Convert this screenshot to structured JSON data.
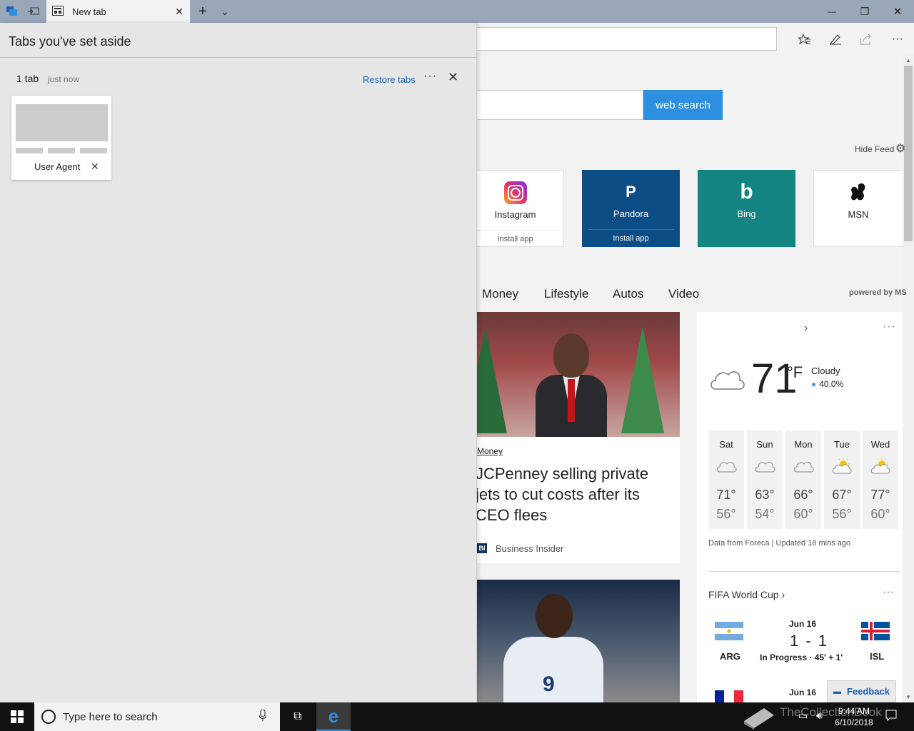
{
  "titlebar": {
    "tab_title": "New tab",
    "tab_close": "✕",
    "new_tab": "+",
    "tab_list": "⌄",
    "minimize": "—",
    "restore": "❐",
    "close": "✕",
    "color": "#9aa7b8"
  },
  "toolbar": {
    "favorites_icon": "star-list-icon",
    "notes_icon": "pen-icon",
    "share_icon": "share-icon",
    "more_icon": "ellipsis-icon",
    "more_label": "···"
  },
  "ntp": {
    "search_button": "web search",
    "hide_feed": "Hide Feed",
    "tiles": [
      {
        "name": "Instagram",
        "install": "Install app"
      },
      {
        "name": "Pandora",
        "letter": "P",
        "install": "Install app"
      },
      {
        "name": "Bing",
        "letter": "b"
      },
      {
        "name": "MSN"
      }
    ],
    "categories": [
      "Money",
      "Lifestyle",
      "Autos",
      "Video"
    ],
    "powered_by": "powered by MS",
    "news": {
      "tag": "Money",
      "title": "JCPenney selling private jets to cut costs after its CEO flees",
      "source_badge": "BI",
      "source": "Business Insider",
      "player_number": "9"
    },
    "weather": {
      "arrow": "›",
      "more": "···",
      "temp": "71",
      "unit": "°F",
      "condition": "Cloudy",
      "precip": "40.0%",
      "drop": "●",
      "days": [
        {
          "name": "Sat",
          "high": "71°",
          "low": "56°",
          "icon": "cloudy-icon"
        },
        {
          "name": "Sun",
          "high": "63°",
          "low": "54°",
          "icon": "cloudy-icon"
        },
        {
          "name": "Mon",
          "high": "66°",
          "low": "60°",
          "icon": "cloudy-icon"
        },
        {
          "name": "Tue",
          "high": "67°",
          "low": "56°",
          "icon": "partly-sunny-icon"
        },
        {
          "name": "Wed",
          "high": "77°",
          "low": "60°",
          "icon": "partly-sunny-icon"
        }
      ],
      "source": "Data from Foreca | Updated 18 mins ago"
    },
    "fifa": {
      "title": "FIFA World Cup ›",
      "more": "···",
      "match1": {
        "date": "Jun 16",
        "score": "1 - 1",
        "status": "In Progress · 45' + 1'",
        "home": "ARG",
        "away": "ISL"
      },
      "match2": {
        "date": "Jun 16"
      }
    },
    "feedback": "Feedback"
  },
  "aside": {
    "title": "Tabs you've set aside",
    "count": "1 tab",
    "time": "just now",
    "restore": "Restore tabs",
    "more": "···",
    "close": "✕",
    "tab_label": "User Agent",
    "tab_close": "✕"
  },
  "taskbar": {
    "search_placeholder": "Type here to search",
    "mic": "🎤",
    "task_view": "⧉",
    "edge": "e",
    "watermark": "TheCollectionBook",
    "time": "9:44 AM",
    "date": "6/10/2018"
  }
}
